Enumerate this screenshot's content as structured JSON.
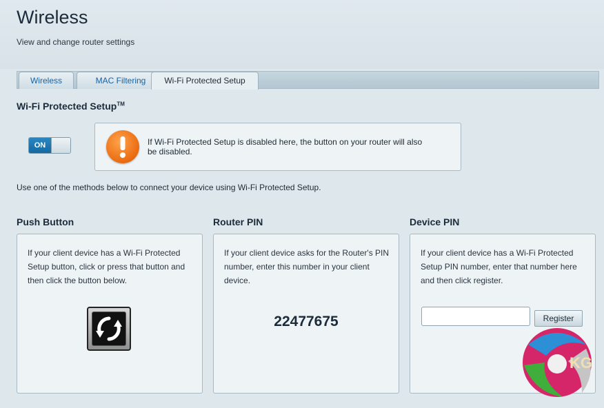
{
  "header": {
    "title": "Wireless",
    "subtitle": "View and change router settings"
  },
  "tabs": [
    {
      "label": "Wireless",
      "active": false
    },
    {
      "label": "MAC Filtering",
      "active": false
    },
    {
      "label": "Wi-Fi Protected Setup",
      "active": true
    }
  ],
  "wps": {
    "title": "Wi-Fi Protected Setup",
    "trademark": "TM",
    "toggle_label": "ON",
    "toggle_state": "on",
    "notice_icon": "warning-icon",
    "notice_text": "If Wi-Fi Protected Setup is disabled here, the button on your router will also be disabled.",
    "instructions": "Use one of the methods below to connect your device using Wi-Fi Protected Setup."
  },
  "push_button": {
    "title": "Push Button",
    "description": "If your client device has a Wi-Fi Protected Setup button, click or press that button and then click the button below.",
    "icon": "wps-arrows-icon"
  },
  "router_pin": {
    "title": "Router PIN",
    "description": "If your client device asks for the Router's PIN number, enter this number in your client device.",
    "pin": "22477675"
  },
  "device_pin": {
    "title": "Device PIN",
    "description": "If your client device has a Wi-Fi Protected Setup PIN number, enter that number here and then click register.",
    "input_value": "",
    "register_label": "Register"
  },
  "watermark": {
    "text": "KG"
  },
  "colors": {
    "accent_blue": "#1a74b0",
    "warning_orange": "#ef7a1a",
    "panel_bg": "#eef3f6",
    "page_bg": "#dde7ec"
  }
}
